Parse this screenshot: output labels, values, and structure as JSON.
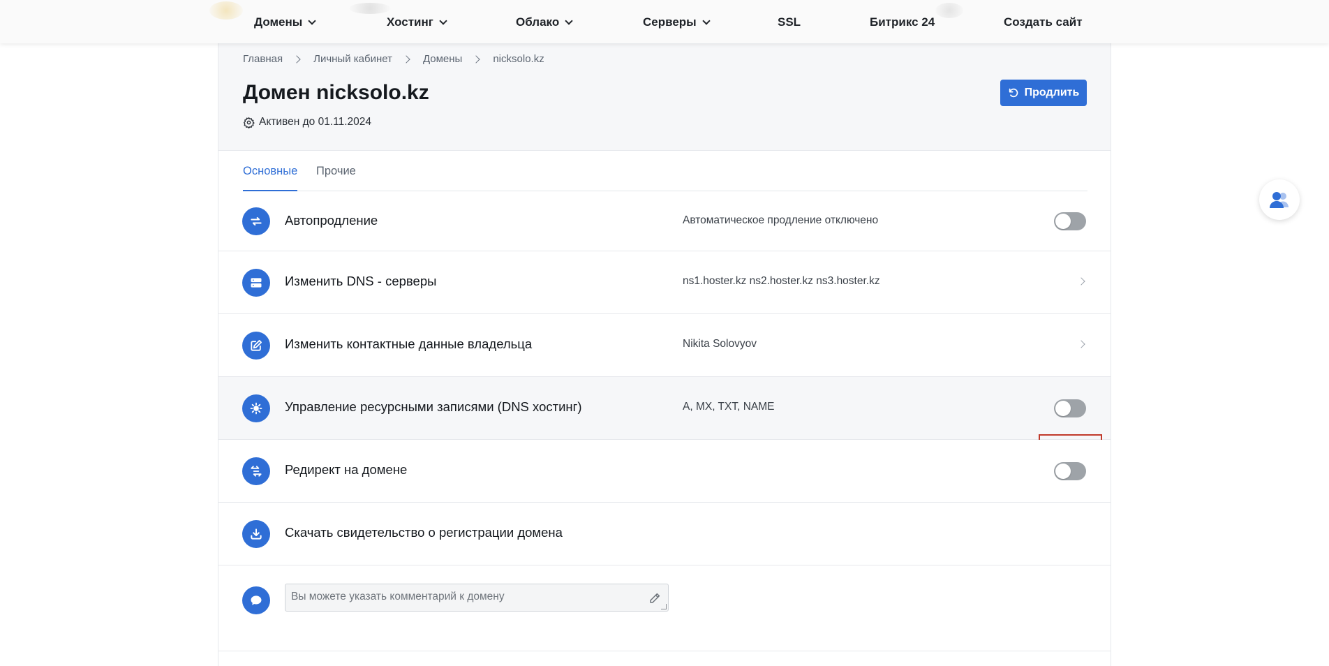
{
  "topnav": {
    "items": [
      {
        "label": "Домены",
        "has_dropdown": true
      },
      {
        "label": "Хостинг",
        "has_dropdown": true
      },
      {
        "label": "Облако",
        "has_dropdown": true
      },
      {
        "label": "Серверы",
        "has_dropdown": true
      },
      {
        "label": "SSL",
        "has_dropdown": false
      },
      {
        "label": "Битрикс 24",
        "has_dropdown": false
      },
      {
        "label": "Создать сайт",
        "has_dropdown": false
      }
    ]
  },
  "breadcrumb": [
    "Главная",
    "Личный кабинет",
    "Домены",
    "nicksolo.kz"
  ],
  "page": {
    "title": "Домен nicksolo.kz",
    "status": "Активен до 01.11.2024",
    "renew_button": "Продлить"
  },
  "tabs": [
    {
      "label": "Основные",
      "active": true
    },
    {
      "label": "Прочие",
      "active": false
    }
  ],
  "rows": [
    {
      "icon": "refresh-arrows-icon",
      "label": "Автопродление",
      "value": "Автоматическое продление отключено",
      "control": "toggle",
      "toggle_on": false
    },
    {
      "icon": "server-icon",
      "label": "Изменить DNS - серверы",
      "value": "ns1.hoster.kz ns2.hoster.kz ns3.hoster.kz",
      "control": "arrow"
    },
    {
      "icon": "edit-icon",
      "label": "Изменить контактные данные владельца",
      "value": "Nikita Solovyov",
      "control": "arrow"
    },
    {
      "icon": "settings-sun-icon",
      "label": "Управление ресурсными записями (DNS хостинг)",
      "value": "A, MX, TXT, NAME",
      "control": "toggle",
      "toggle_on": false,
      "highlighted": true
    },
    {
      "icon": "redirect-icon",
      "label": "Редирект на домене",
      "value": "",
      "control": "toggle",
      "toggle_on": false
    },
    {
      "icon": "download-icon",
      "label": "Скачать свидетельство о регистрации домена",
      "value": "",
      "control": "none"
    }
  ],
  "comment": {
    "icon": "chat-bubble-icon",
    "placeholder": "Вы можете указать комментарий к домену",
    "value": ""
  },
  "floating_button": {
    "icon": "users-icon"
  },
  "colors": {
    "accent": "#2f6ed6",
    "toggle_off": "#9ea3a8",
    "highlight_border": "#c0392b",
    "header_bg": "#f6f7f9"
  }
}
